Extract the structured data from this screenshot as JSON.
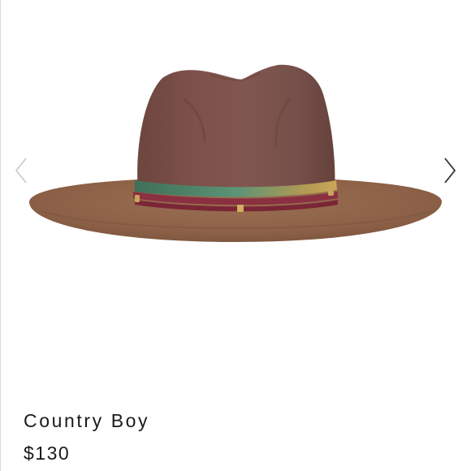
{
  "carousel": {
    "image_subject": "brown wide-brim felt fedora hat with braided band",
    "prev_icon": "chevron-left-icon",
    "next_icon": "chevron-right-icon"
  },
  "product": {
    "title": "Country Boy",
    "price": "$130"
  },
  "colors": {
    "crown": "#7a5048",
    "brim": "#8e6448",
    "band_green": "#4f8468",
    "band_burgundy": "#8a3040",
    "band_gold": "#c9a45a",
    "text": "#1a1a1a",
    "prev_arrow": "#c8c8c8",
    "next_arrow": "#333333"
  }
}
